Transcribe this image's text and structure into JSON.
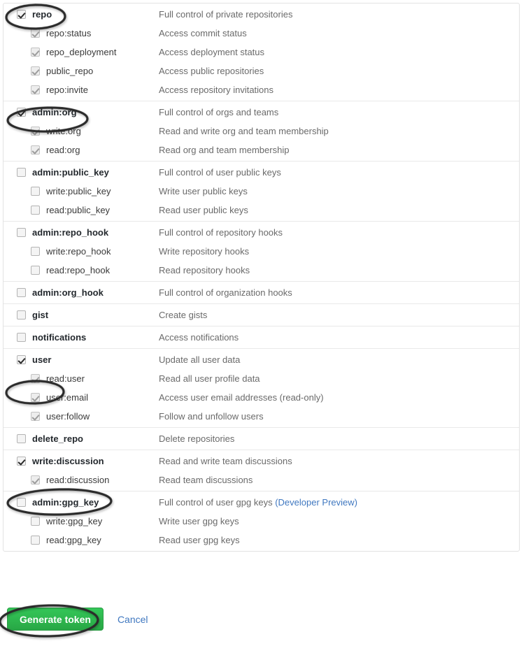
{
  "page": {
    "title": "GitHub personal access token scopes"
  },
  "scope_groups": [
    {
      "rows": [
        {
          "name": "repo",
          "desc": "Full control of private repositories",
          "level": "parent",
          "checked": true,
          "disabled": false,
          "highlighted": true
        },
        {
          "name": "repo:status",
          "desc": "Access commit status",
          "level": "child",
          "checked": true,
          "disabled": true,
          "highlighted": false
        },
        {
          "name": "repo_deployment",
          "desc": "Access deployment status",
          "level": "child",
          "checked": true,
          "disabled": true,
          "highlighted": false
        },
        {
          "name": "public_repo",
          "desc": "Access public repositories",
          "level": "child",
          "checked": true,
          "disabled": true,
          "highlighted": false
        },
        {
          "name": "repo:invite",
          "desc": "Access repository invitations",
          "level": "child",
          "checked": true,
          "disabled": true,
          "highlighted": false
        }
      ]
    },
    {
      "rows": [
        {
          "name": "admin:org",
          "desc": "Full control of orgs and teams",
          "level": "parent",
          "checked": true,
          "disabled": false,
          "highlighted": true
        },
        {
          "name": "write:org",
          "desc": "Read and write org and team membership",
          "level": "child",
          "checked": true,
          "disabled": true,
          "highlighted": false
        },
        {
          "name": "read:org",
          "desc": "Read org and team membership",
          "level": "child",
          "checked": true,
          "disabled": true,
          "highlighted": false
        }
      ]
    },
    {
      "rows": [
        {
          "name": "admin:public_key",
          "desc": "Full control of user public keys",
          "level": "parent",
          "checked": false,
          "disabled": false,
          "highlighted": false
        },
        {
          "name": "write:public_key",
          "desc": "Write user public keys",
          "level": "child",
          "checked": false,
          "disabled": false,
          "highlighted": false
        },
        {
          "name": "read:public_key",
          "desc": "Read user public keys",
          "level": "child",
          "checked": false,
          "disabled": false,
          "highlighted": false
        }
      ]
    },
    {
      "rows": [
        {
          "name": "admin:repo_hook",
          "desc": "Full control of repository hooks",
          "level": "parent",
          "checked": false,
          "disabled": false,
          "highlighted": false
        },
        {
          "name": "write:repo_hook",
          "desc": "Write repository hooks",
          "level": "child",
          "checked": false,
          "disabled": false,
          "highlighted": false
        },
        {
          "name": "read:repo_hook",
          "desc": "Read repository hooks",
          "level": "child",
          "checked": false,
          "disabled": false,
          "highlighted": false
        }
      ]
    },
    {
      "rows": [
        {
          "name": "admin:org_hook",
          "desc": "Full control of organization hooks",
          "level": "parent",
          "checked": false,
          "disabled": false,
          "highlighted": false
        }
      ]
    },
    {
      "rows": [
        {
          "name": "gist",
          "desc": "Create gists",
          "level": "parent",
          "checked": false,
          "disabled": false,
          "highlighted": false
        }
      ]
    },
    {
      "rows": [
        {
          "name": "notifications",
          "desc": "Access notifications",
          "level": "parent",
          "checked": false,
          "disabled": false,
          "highlighted": false
        }
      ]
    },
    {
      "rows": [
        {
          "name": "user",
          "desc": "Update all user data",
          "level": "parent",
          "checked": true,
          "disabled": false,
          "highlighted": true
        },
        {
          "name": "read:user",
          "desc": "Read all user profile data",
          "level": "child",
          "checked": true,
          "disabled": true,
          "highlighted": false
        },
        {
          "name": "user:email",
          "desc": "Access user email addresses (read-only)",
          "level": "child",
          "checked": true,
          "disabled": true,
          "highlighted": false
        },
        {
          "name": "user:follow",
          "desc": "Follow and unfollow users",
          "level": "child",
          "checked": true,
          "disabled": true,
          "highlighted": false
        }
      ]
    },
    {
      "rows": [
        {
          "name": "delete_repo",
          "desc": "Delete repositories",
          "level": "parent",
          "checked": false,
          "disabled": false,
          "highlighted": false
        }
      ]
    },
    {
      "rows": [
        {
          "name": "write:discussion",
          "desc": "Read and write team discussions",
          "level": "parent",
          "checked": true,
          "disabled": false,
          "highlighted": true
        },
        {
          "name": "read:discussion",
          "desc": "Read team discussions",
          "level": "child",
          "checked": true,
          "disabled": true,
          "highlighted": false
        }
      ]
    },
    {
      "rows": [
        {
          "name": "admin:gpg_key",
          "desc": "Full control of user gpg keys ",
          "desc_link": "(Developer Preview)",
          "level": "parent",
          "checked": false,
          "disabled": false,
          "highlighted": false
        },
        {
          "name": "write:gpg_key",
          "desc": "Write user gpg keys",
          "level": "child",
          "checked": false,
          "disabled": false,
          "highlighted": false
        },
        {
          "name": "read:gpg_key",
          "desc": "Read user gpg keys",
          "level": "child",
          "checked": false,
          "disabled": false,
          "highlighted": false
        }
      ]
    }
  ],
  "footer": {
    "generate_label": "Generate token",
    "cancel_label": "Cancel",
    "generate_color": "#28a745",
    "link_color": "#4078c0",
    "highlighted": true
  },
  "highlight": {
    "stroke_color": "#2b2b2b",
    "shape": "hand-drawn-ellipse"
  }
}
